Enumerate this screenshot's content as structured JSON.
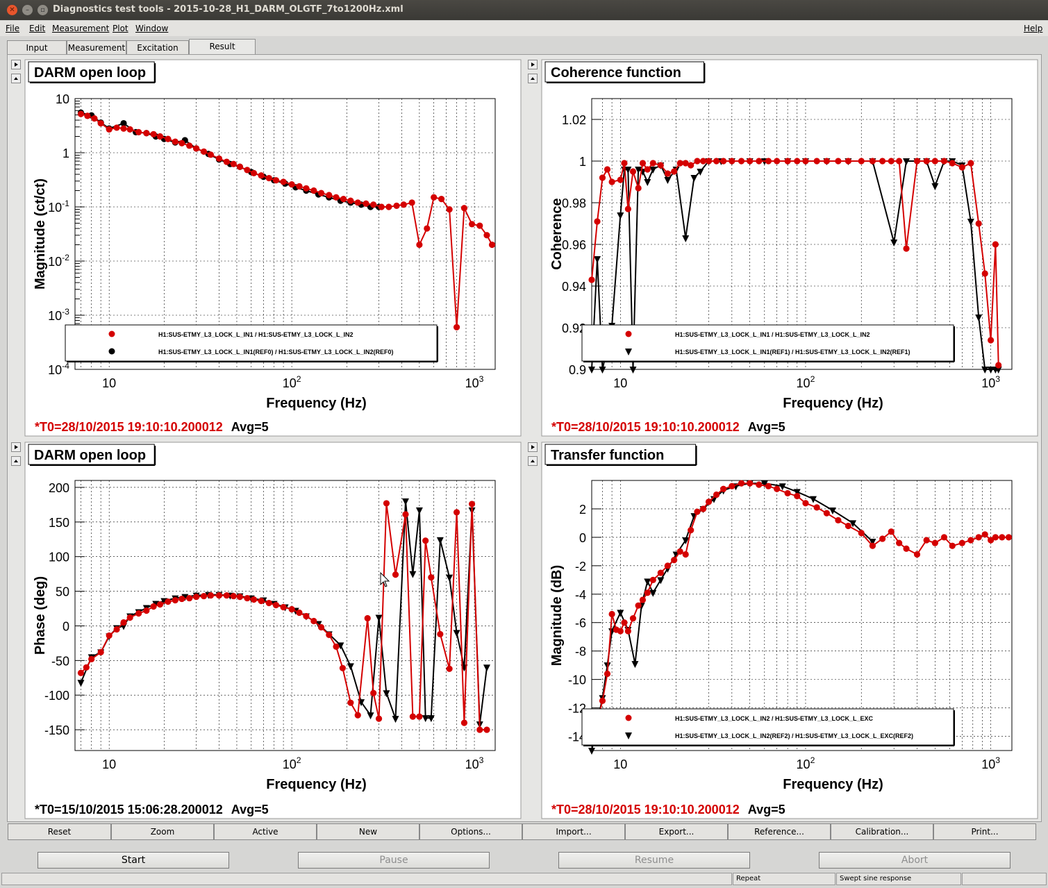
{
  "window": {
    "title": "Diagnostics test tools - 2015-10-28_H1_DARM_OLGTF_7to1200Hz.xml"
  },
  "menu": [
    "File",
    "Edit",
    "Measurement",
    "Plot",
    "Window"
  ],
  "help": "Help",
  "tabs": [
    "Input",
    "Measurement",
    "Excitation",
    "Result"
  ],
  "active_tab": "Result",
  "colors": {
    "red": "#d40000",
    "black": "#000000",
    "grid": "#000000"
  },
  "panels": {
    "top_left": {
      "title": "DARM open loop",
      "footer_t0": "*T0=28/10/2015 19:10:10.200012",
      "footer_avg": "Avg=5",
      "footer_color": "#d40000"
    },
    "top_right": {
      "title": "Coherence function",
      "footer_t0": "*T0=28/10/2015 19:10:10.200012",
      "footer_avg": "Avg=5",
      "footer_color": "#d40000"
    },
    "bottom_left": {
      "title": "DARM open loop",
      "footer_t0": "*T0=15/10/2015 15:06:28.200012",
      "footer_avg": "Avg=5",
      "footer_color": "#000000"
    },
    "bottom_right": {
      "title": "Transfer function",
      "footer_t0": "*T0=28/10/2015 19:10:10.200012",
      "footer_avg": "Avg=5",
      "footer_color": "#d40000"
    }
  },
  "chart_data": [
    {
      "id": "mag",
      "type": "scatter",
      "xscale": "log",
      "yscale": "log",
      "xlim": [
        6.5,
        1300
      ],
      "ylim": [
        0.0001,
        10
      ],
      "xlabel": "Frequency (Hz)",
      "ylabel": "Magnitude (ct/ct)",
      "xticks": [
        "10",
        "10^2",
        "10^3"
      ],
      "yticks": [
        "10^-4",
        "10^-3",
        "10^-2",
        "10^-1",
        "1",
        "10"
      ],
      "legend": [
        "H1:SUS-ETMY_L3_LOCK_L_IN1 / H1:SUS-ETMY_L3_LOCK_L_IN2",
        "H1:SUS-ETMY_L3_LOCK_L_IN1(REF0) / H1:SUS-ETMY_L3_LOCK_L_IN2(REF0)"
      ],
      "series": [
        {
          "name": "H1:SUS-ETMY_L3_LOCK_L_IN1 / H1:SUS-ETMY_L3_LOCK_L_IN2",
          "color": "#d40000",
          "marker": "circle",
          "x": [
            7,
            7.6,
            8.3,
            9,
            10,
            11,
            12,
            13,
            14.5,
            16,
            17.5,
            19,
            21,
            23,
            25,
            27.5,
            30,
            33,
            36,
            40,
            44,
            48,
            52,
            57,
            62,
            68,
            75,
            82,
            90,
            100,
            110,
            120,
            132,
            145,
            160,
            175,
            192,
            210,
            230,
            255,
            280,
            310,
            340,
            375,
            410,
            455,
            500,
            550,
            600,
            660,
            730,
            800,
            880,
            970,
            1070,
            1170,
            1250
          ],
          "y": [
            5.2,
            4.8,
            4.3,
            3.5,
            2.7,
            2.9,
            2.8,
            2.7,
            2.4,
            2.3,
            2.2,
            2.0,
            1.8,
            1.6,
            1.5,
            1.35,
            1.2,
            1.05,
            0.92,
            0.78,
            0.68,
            0.62,
            0.55,
            0.48,
            0.42,
            0.38,
            0.34,
            0.31,
            0.29,
            0.26,
            0.24,
            0.22,
            0.2,
            0.18,
            0.165,
            0.15,
            0.14,
            0.13,
            0.12,
            0.115,
            0.11,
            0.1,
            0.1,
            0.105,
            0.11,
            0.12,
            0.02,
            0.04,
            0.15,
            0.14,
            0.09,
            0.0006,
            0.095,
            0.048,
            0.045,
            0.03,
            0.02
          ]
        },
        {
          "name": "H1:SUS-ETMY_L3_LOCK_L_IN1(REF0) / H1:SUS-ETMY_L3_LOCK_L_IN2(REF0)",
          "color": "#000000",
          "marker": "circle",
          "x": [
            7,
            8,
            9,
            10,
            12,
            14,
            16,
            18,
            20,
            23,
            26,
            30,
            35,
            40,
            46,
            52,
            60,
            70,
            80,
            92,
            105,
            120,
            140,
            160,
            185,
            210,
            240,
            270,
            300
          ],
          "y": [
            5.5,
            4.9,
            3.6,
            2.8,
            3.5,
            2.4,
            2.3,
            2.0,
            1.8,
            1.55,
            1.7,
            1.2,
            0.95,
            0.75,
            0.62,
            0.55,
            0.44,
            0.36,
            0.31,
            0.27,
            0.23,
            0.2,
            0.17,
            0.15,
            0.13,
            0.12,
            0.11,
            0.1,
            0.1
          ]
        }
      ]
    },
    {
      "id": "coh",
      "type": "line",
      "xscale": "log",
      "xlim": [
        7,
        1300
      ],
      "ylim": [
        0.9,
        1.03
      ],
      "xlabel": "Frequency (Hz)",
      "ylabel": "Coherence",
      "xticks": [
        "10",
        "10^2",
        "10^3"
      ],
      "yticks": [
        "0.9",
        "0.92",
        "0.94",
        "0.96",
        "0.98",
        "1",
        "1.02"
      ],
      "legend": [
        "H1:SUS-ETMY_L3_LOCK_L_IN1 / H1:SUS-ETMY_L3_LOCK_L_IN2",
        "H1:SUS-ETMY_L3_LOCK_L_IN1(REF1) / H1:SUS-ETMY_L3_LOCK_L_IN2(REF1)"
      ],
      "series": [
        {
          "name": "H1:SUS-ETMY_L3_LOCK_L_IN1 / H1:SUS-ETMY_L3_LOCK_L_IN2",
          "color": "#d40000",
          "marker": "circle",
          "x": [
            7,
            7.5,
            8,
            8.5,
            9,
            10,
            10.5,
            11,
            11.7,
            12.5,
            13.2,
            14,
            15,
            16.5,
            18,
            19.5,
            21,
            22.5,
            24,
            26,
            28,
            30,
            33,
            36,
            40,
            45,
            50,
            56,
            63,
            70,
            80,
            90,
            100,
            115,
            130,
            150,
            170,
            200,
            230,
            260,
            290,
            320,
            350,
            400,
            450,
            500,
            560,
            620,
            700,
            780,
            860,
            930,
            1000,
            1060,
            1100
          ],
          "y": [
            0.943,
            0.971,
            0.992,
            0.996,
            0.99,
            0.991,
            0.999,
            0.977,
            0.995,
            0.987,
            0.999,
            0.996,
            0.999,
            0.998,
            0.994,
            0.995,
            0.999,
            0.999,
            0.998,
            1,
            1,
            1,
            1,
            1,
            1,
            1,
            1,
            1,
            1,
            1,
            1,
            1,
            1,
            1,
            1,
            1,
            1,
            1,
            1,
            1,
            1,
            1,
            0.958,
            1,
            1,
            1,
            1,
            0.999,
            0.997,
            0.999,
            0.97,
            0.946,
            0.914,
            0.96,
            0.902
          ]
        },
        {
          "name": "H1:SUS-ETMY_L3_LOCK_L_IN1(REF1) / H1:SUS-ETMY_L3_LOCK_L_IN2(REF1)",
          "color": "#000000",
          "marker": "triangle",
          "x": [
            7,
            7.5,
            8,
            9,
            10,
            10.5,
            11,
            11.7,
            12.5,
            13.2,
            14,
            15,
            16.5,
            18,
            20,
            22.5,
            25,
            27,
            30,
            35,
            40,
            50,
            60,
            80,
            100,
            130,
            170,
            230,
            300,
            350,
            400,
            450,
            500,
            560,
            620,
            700,
            780,
            860,
            930,
            1000,
            1060,
            1100
          ],
          "y": [
            0.9,
            0.953,
            0.9,
            0.921,
            0.974,
            0.996,
            0.996,
            0.9,
            0.996,
            0.995,
            0.99,
            0.996,
            0.998,
            0.991,
            0.996,
            0.963,
            0.992,
            0.995,
            1,
            1,
            1,
            1,
            1,
            1,
            1,
            1,
            1,
            1,
            0.961,
            1,
            1,
            1,
            0.988,
            1,
            1,
            0.998,
            0.971,
            0.925,
            0.9,
            0.9,
            0.9,
            0.9
          ]
        }
      ]
    },
    {
      "id": "phase",
      "type": "line",
      "xscale": "log",
      "xlim": [
        6.5,
        1300
      ],
      "ylim": [
        -180,
        210
      ],
      "xlabel": "Frequency (Hz)",
      "ylabel": "Phase (deg)",
      "xticks": [
        "10",
        "10^2",
        "10^3"
      ],
      "yticks": [
        "-150",
        "-100",
        "-50",
        "0",
        "50",
        "100",
        "150",
        "200"
      ],
      "series": [
        {
          "name": "",
          "color": "#d40000",
          "marker": "circle",
          "x": [
            7,
            7.5,
            8,
            9,
            10,
            11,
            12,
            13,
            14.5,
            16,
            17.5,
            19,
            21,
            23,
            25,
            27.5,
            30,
            33,
            36,
            40,
            44,
            48,
            52,
            57,
            62,
            68,
            75,
            82,
            90,
            100,
            110,
            120,
            132,
            145,
            160,
            175,
            190,
            210,
            230,
            260,
            280,
            300,
            330,
            370,
            420,
            460,
            500,
            540,
            580,
            650,
            730,
            800,
            880,
            970,
            1070,
            1170
          ],
          "y": [
            -68,
            -60,
            -48,
            -38,
            -14,
            -5,
            5,
            12,
            18,
            22,
            28,
            31,
            35,
            37,
            39,
            40,
            42,
            43,
            44,
            44,
            44,
            43,
            42,
            40,
            38,
            36,
            33,
            30,
            27,
            24,
            19,
            14,
            7,
            -2,
            -13,
            -30,
            -61,
            -111,
            -129,
            11,
            -97,
            -134,
            177,
            74,
            161,
            -131,
            -131,
            123,
            70,
            -12,
            -62,
            164,
            -140,
            176,
            -150,
            -150
          ]
        },
        {
          "name": "",
          "color": "#000000",
          "marker": "triangle",
          "x": [
            7,
            8,
            9,
            10,
            11,
            12,
            13,
            14.5,
            16,
            18,
            20,
            23,
            26,
            30,
            35,
            40,
            46,
            52,
            60,
            70,
            80,
            92,
            105,
            120,
            140,
            160,
            185,
            210,
            240,
            270,
            300,
            330,
            370,
            420,
            460,
            500,
            540,
            580,
            650,
            730,
            800,
            880,
            970,
            1070,
            1170
          ],
          "y": [
            -82,
            -45,
            -38,
            -15,
            -3,
            0,
            14,
            20,
            26,
            32,
            36,
            40,
            42,
            44,
            45,
            45,
            44,
            43,
            40,
            37,
            32,
            27,
            22,
            14,
            3,
            -12,
            -28,
            -58,
            -110,
            -129,
            12,
            -97,
            -134,
            180,
            75,
            167,
            -133,
            -133,
            124,
            70,
            -10,
            -60,
            167,
            -142,
            -60
          ]
        }
      ]
    },
    {
      "id": "tf",
      "type": "line",
      "xscale": "log",
      "xlim": [
        7,
        1300
      ],
      "ylim": [
        -15,
        4
      ],
      "xlabel": "Frequency (Hz)",
      "ylabel": "Magnitude (dB)",
      "xticks": [
        "10",
        "10^2",
        "10^3"
      ],
      "yticks": [
        "-14",
        "-12",
        "-10",
        "-8",
        "-6",
        "-4",
        "-2",
        "0",
        "2"
      ],
      "legend": [
        "H1:SUS-ETMY_L3_LOCK_L_IN2 / H1:SUS-ETMY_L3_LOCK_L_EXC",
        "H1:SUS-ETMY_L3_LOCK_L_IN2(REF2) / H1:SUS-ETMY_L3_LOCK_L_EXC(REF2)"
      ],
      "series": [
        {
          "name": "H1:SUS-ETMY_L3_LOCK_L_IN2 / H1:SUS-ETMY_L3_LOCK_L_EXC",
          "color": "#d40000",
          "marker": "circle",
          "x": [
            7,
            7.5,
            8,
            8.5,
            9,
            9.5,
            10,
            10.5,
            11,
            11.7,
            12.5,
            13.2,
            14,
            15,
            16.5,
            18,
            19.5,
            21,
            22.5,
            24,
            26,
            28,
            30,
            33,
            36,
            40,
            45,
            50,
            56,
            63,
            70,
            80,
            90,
            100,
            115,
            130,
            150,
            170,
            200,
            230,
            260,
            290,
            320,
            350,
            400,
            450,
            500,
            560,
            620,
            700,
            780,
            860,
            930,
            1000,
            1060,
            1150,
            1250
          ],
          "y": [
            -13.7,
            -13.0,
            -11.5,
            -9.6,
            -5.4,
            -6.5,
            -6.6,
            -6.0,
            -6.6,
            -5.7,
            -4.8,
            -4.4,
            -3.9,
            -3.0,
            -2.5,
            -2.0,
            -1.6,
            -1.0,
            -1.2,
            0.5,
            1.8,
            2.0,
            2.5,
            3.0,
            3.4,
            3.6,
            3.8,
            3.8,
            3.7,
            3.6,
            3.4,
            3.1,
            2.9,
            2.4,
            2.1,
            1.7,
            1.2,
            0.8,
            0.3,
            -0.6,
            -0.1,
            0.4,
            -0.4,
            -0.8,
            -1.2,
            -0.2,
            -0.4,
            0.0,
            -0.6,
            -0.4,
            -0.2,
            0.0,
            0.2,
            -0.2,
            0.0,
            0.0,
            0.0
          ]
        },
        {
          "name": "H1:SUS-ETMY_L3_LOCK_L_IN2(REF2) / H1:SUS-ETMY_L3_LOCK_L_EXC(REF2)",
          "color": "#000000",
          "marker": "triangle",
          "x": [
            7,
            7.5,
            8,
            8.5,
            9,
            10,
            11,
            12,
            13,
            14,
            15,
            16.5,
            18,
            20,
            22.5,
            25,
            28,
            32,
            36,
            42,
            50,
            60,
            75,
            90,
            110,
            140,
            180,
            230
          ],
          "y": [
            -15.2,
            -13.0,
            -11.3,
            -9.0,
            -6.6,
            -5.3,
            -6.5,
            -8.9,
            -4.8,
            -3.1,
            -3.9,
            -3.0,
            -2.2,
            -1.2,
            -0.2,
            1.5,
            2.0,
            2.7,
            3.3,
            3.6,
            3.8,
            3.8,
            3.6,
            3.2,
            2.7,
            1.9,
            1.0,
            -0.3
          ]
        }
      ]
    }
  ],
  "bottom_toolbar": [
    "Reset",
    "Zoom",
    "Active",
    "New",
    "Options...",
    "Import...",
    "Export...",
    "Reference...",
    "Calibration...",
    "Print..."
  ],
  "controls": {
    "start": "Start",
    "pause": "Pause",
    "resume": "Resume",
    "abort": "Abort"
  },
  "statusbar": {
    "left": "",
    "repeat": "Repeat",
    "mode": "Swept sine response"
  }
}
